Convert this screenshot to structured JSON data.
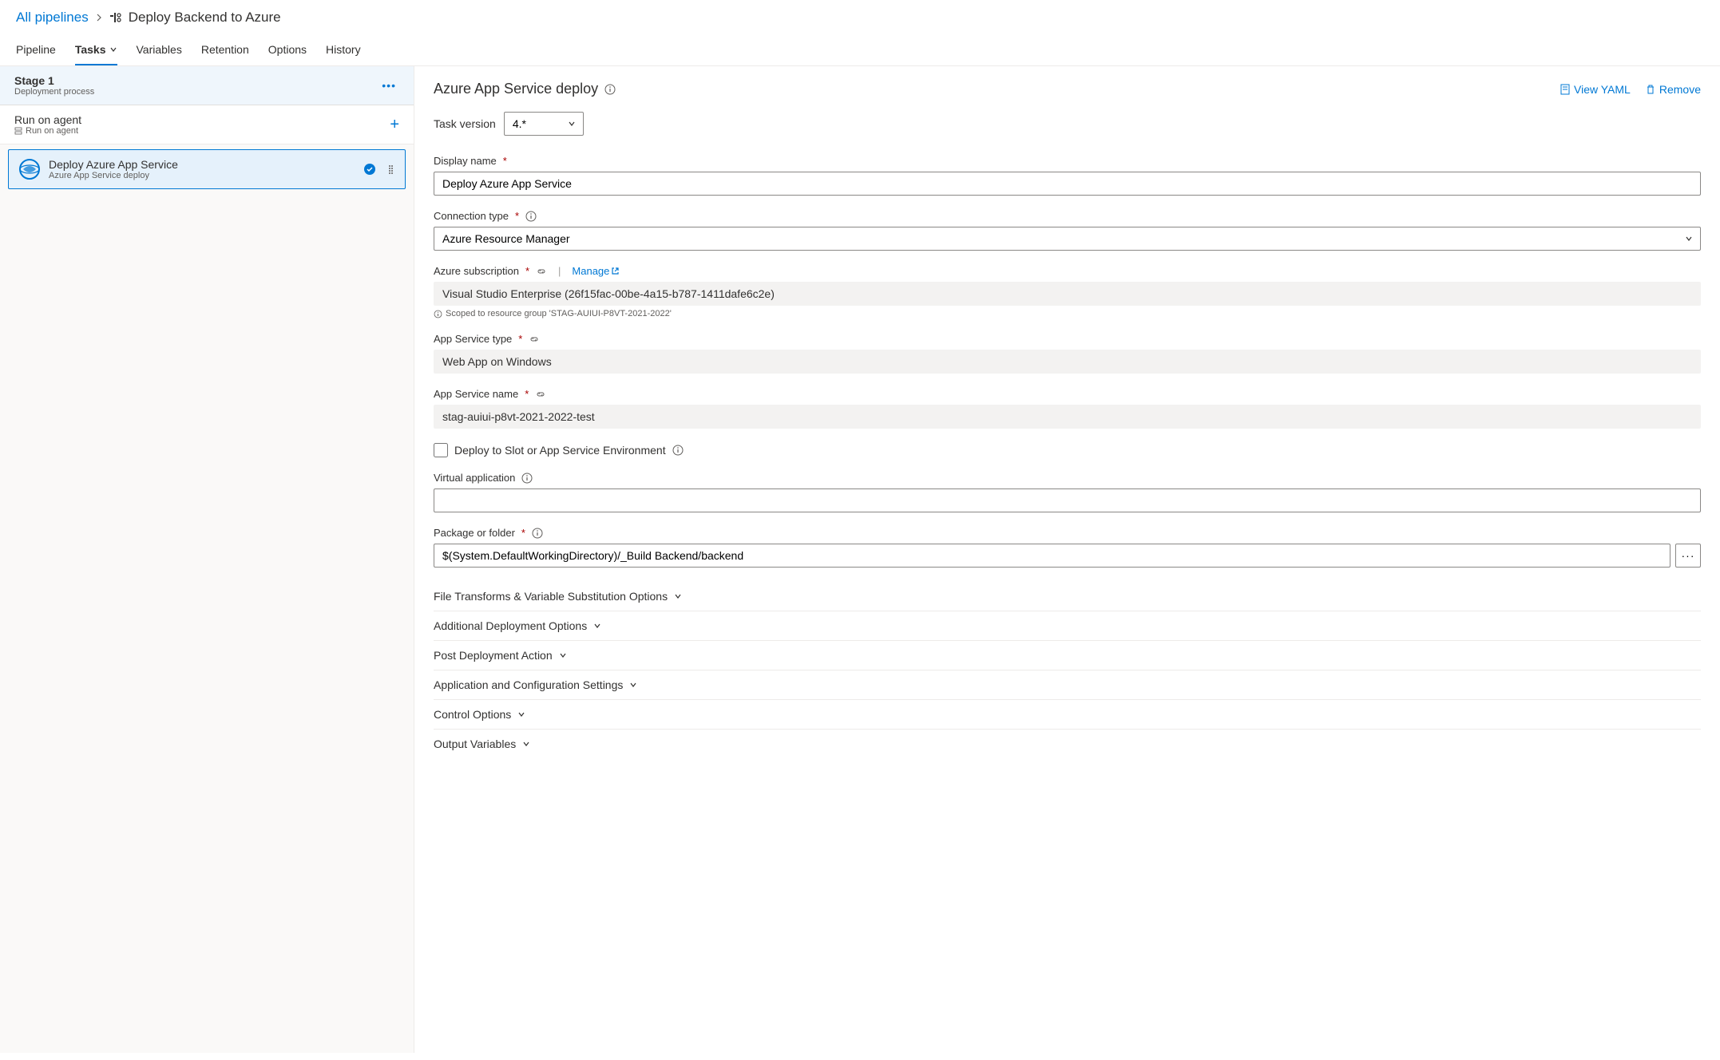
{
  "breadcrumb": {
    "root": "All pipelines",
    "current": "Deploy Backend to Azure"
  },
  "tabs": [
    "Pipeline",
    "Tasks",
    "Variables",
    "Retention",
    "Options",
    "History"
  ],
  "activeTab": "Tasks",
  "stage": {
    "name": "Stage 1",
    "subtitle": "Deployment process"
  },
  "agent": {
    "title": "Run on agent",
    "subtitle": "Run on agent"
  },
  "task": {
    "title": "Deploy Azure App Service",
    "subtitle": "Azure App Service deploy"
  },
  "panel": {
    "title": "Azure App Service deploy",
    "viewYaml": "View YAML",
    "remove": "Remove",
    "taskVersionLabel": "Task version",
    "taskVersionValue": "4.*",
    "displayNameLabel": "Display name",
    "displayNameValue": "Deploy Azure App Service",
    "connectionTypeLabel": "Connection type",
    "connectionTypeValue": "Azure Resource Manager",
    "subscriptionLabel": "Azure subscription",
    "manageLabel": "Manage",
    "subscriptionValue": "Visual Studio Enterprise (26f15fac-00be-4a15-b787-1411dafe6c2e)",
    "subscriptionHelper": "Scoped to resource group 'STAG-AUIUI-P8VT-2021-2022'",
    "appServiceTypeLabel": "App Service type",
    "appServiceTypeValue": "Web App on Windows",
    "appServiceNameLabel": "App Service name",
    "appServiceNameValue": "stag-auiui-p8vt-2021-2022-test",
    "deployToSlotLabel": "Deploy to Slot or App Service Environment",
    "virtualAppLabel": "Virtual application",
    "virtualAppValue": "",
    "packageLabel": "Package or folder",
    "packageValue": "$(System.DefaultWorkingDirectory)/_Build Backend/backend",
    "sections": [
      "File Transforms & Variable Substitution Options",
      "Additional Deployment Options",
      "Post Deployment Action",
      "Application and Configuration Settings",
      "Control Options",
      "Output Variables"
    ]
  }
}
